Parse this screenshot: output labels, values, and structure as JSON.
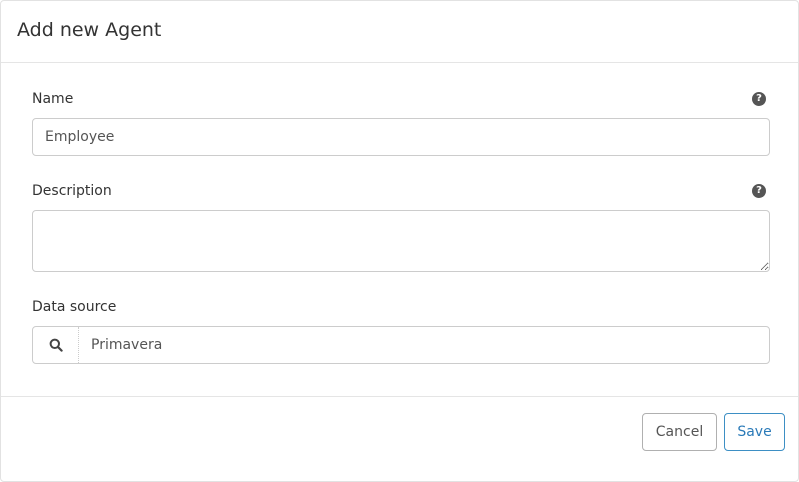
{
  "modal": {
    "title": "Add new Agent"
  },
  "form": {
    "name": {
      "label": "Name",
      "value": "Employee",
      "help_icon": "question-circle-icon"
    },
    "description": {
      "label": "Description",
      "value": "",
      "help_icon": "question-circle-icon"
    },
    "data_source": {
      "label": "Data source",
      "value": "Primavera",
      "icon": "search-icon"
    }
  },
  "footer": {
    "cancel_label": "Cancel",
    "save_label": "Save"
  },
  "colors": {
    "accent": "#2a7ab8",
    "border": "#cccccc",
    "help_icon_bg": "#555555"
  }
}
